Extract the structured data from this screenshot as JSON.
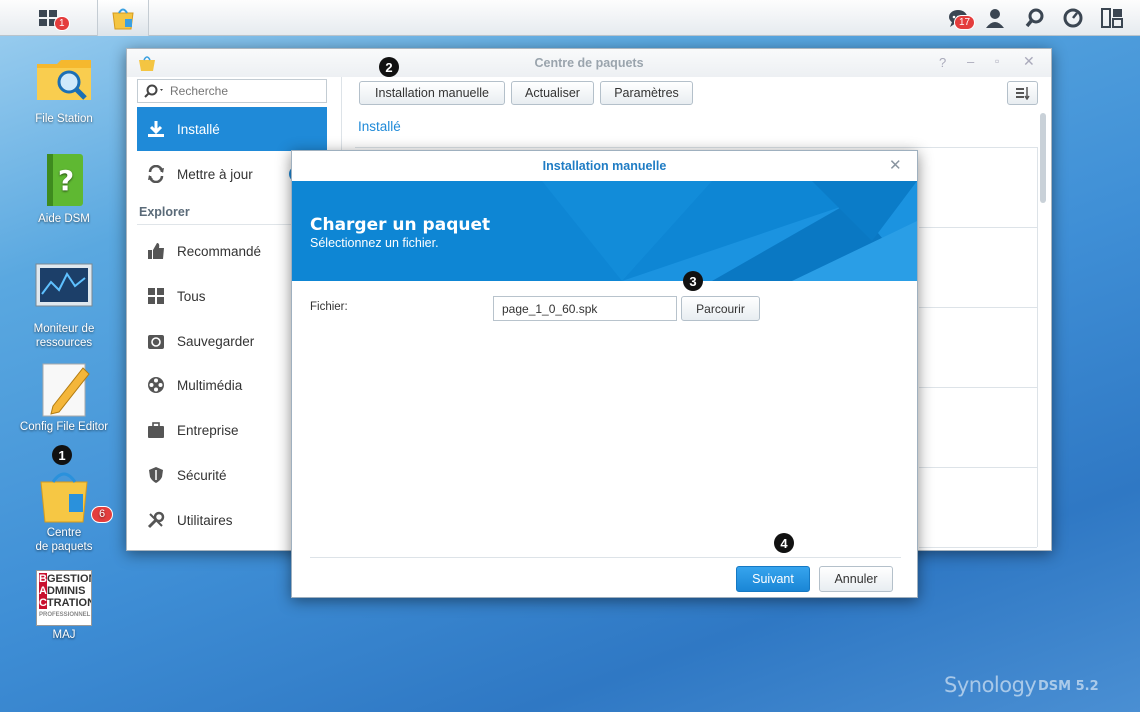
{
  "taskbar": {
    "main_menu_badge": "1",
    "notifications_badge": "17"
  },
  "desktop": {
    "file_station": "File Station",
    "aide_dsm": "Aide DSM",
    "moniteur_line1": "Moniteur de",
    "moniteur_line2": "ressources",
    "config_editor": "Config File Editor",
    "centre_line1": "Centre",
    "centre_line2": "de paquets",
    "centre_badge": "6",
    "maj_logo_lines": [
      "BGESTION",
      "ADMINIS",
      "CTRATION",
      "PROFESSIONNEL"
    ],
    "maj": "MAJ"
  },
  "package_center": {
    "title": "Centre de paquets",
    "search_placeholder": "Recherche",
    "btn_manual": "Installation manuelle",
    "btn_refresh": "Actualiser",
    "btn_settings": "Paramètres",
    "section_title": "Installé",
    "sidebar": {
      "installed": "Installé",
      "update": "Mettre à jour",
      "explore_header": "Explorer",
      "recommended": "Recommandé",
      "all": "Tous",
      "backup": "Sauvegarder",
      "multimedia": "Multimédia",
      "business": "Entreprise",
      "security": "Sécurité",
      "utilities": "Utilitaires"
    }
  },
  "dialog": {
    "title": "Installation manuelle",
    "banner_title": "Charger un paquet",
    "banner_subtitle": "Sélectionnez un fichier.",
    "file_label": "Fichier:",
    "file_value": "page_1_0_60.spk",
    "browse": "Parcourir",
    "next": "Suivant",
    "cancel": "Annuler"
  },
  "steps": {
    "s1": "1",
    "s2": "2",
    "s3": "3",
    "s4": "4"
  },
  "branding": {
    "synology": "Synology",
    "dsm": "DSM 5.2"
  },
  "colors": {
    "accent": "#1f8ad8",
    "banner": "#0e86d4",
    "step_marker": "#111111"
  }
}
